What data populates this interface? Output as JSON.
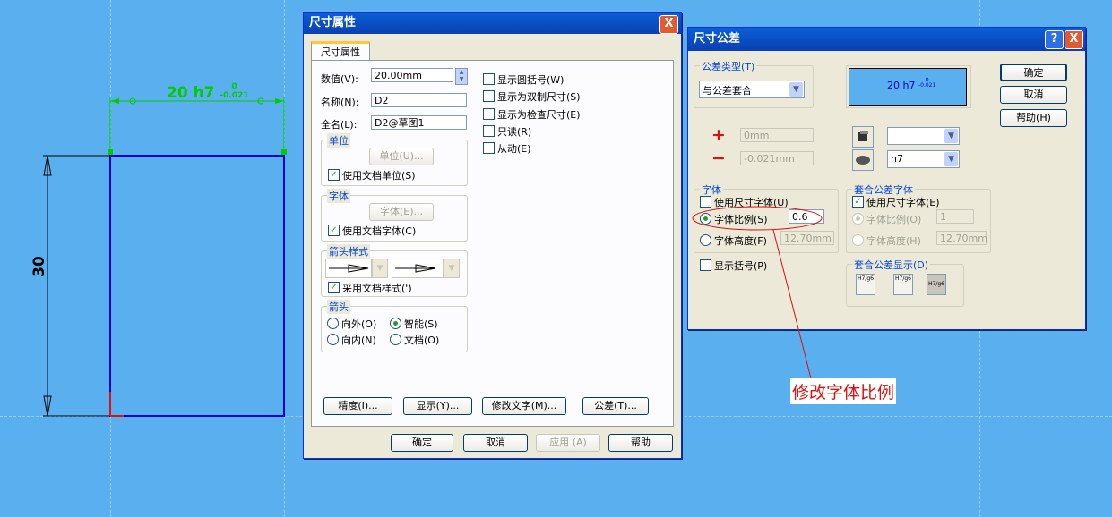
{
  "canvas": {
    "dim_h_text": "20 h7",
    "dim_h_upper": "0",
    "dim_h_lower": "-0.021",
    "dim_v_text": "30"
  },
  "dim_props": {
    "title": "尺寸属性",
    "close": "X",
    "tab": "尺寸属性",
    "value_label": "数值(V):",
    "value": "20.00mm",
    "name_label": "名称(N):",
    "name": "D2",
    "fullname_label": "全名(L):",
    "fullname": "D2@草图1",
    "checks": [
      "显示圆括号(W)",
      "显示为双制尺寸(S)",
      "显示为检查尺寸(E)",
      "只读(R)",
      "从动(E)"
    ],
    "unit_group": "单位",
    "unit_button": "单位(U)...",
    "unit_check": "使用文档单位(S)",
    "font_group": "字体",
    "font_button": "字体(E)...",
    "font_check": "使用文档字体(C)",
    "arrow_style_group": "箭头样式",
    "arrow_style_check": "采用文档样式(')",
    "arrow_group": "箭头",
    "radio_out": "向外(O)",
    "radio_smart": "智能(S)",
    "radio_in": "向内(N)",
    "radio_doc": "文档(O)",
    "precision_button": "精度(I)...",
    "display_button": "显示(Y)...",
    "modify_text_button": "修改文字(M)...",
    "tolerance_button": "公差(T)...",
    "ok": "确定",
    "cancel": "取消",
    "apply": "应用 (A)",
    "help": "帮助"
  },
  "tolerance": {
    "title": "尺寸公差",
    "help_icon": "?",
    "close": "X",
    "type_group": "公差类型(T)",
    "type_value": "与公差套合",
    "preview_main": "20 h7",
    "preview_upper": "0",
    "preview_lower": "-0.021",
    "ok": "确定",
    "cancel": "取消",
    "help": "帮助(H)",
    "plus": "+",
    "minus": "−",
    "plus_value": "0mm",
    "minus_value": "-0.021mm",
    "hole_select": "",
    "shaft_select": "h7",
    "font_group": "字体",
    "use_dim_font": "使用尺寸字体(U)",
    "font_ratio": "字体比例(S)",
    "font_ratio_value": "0.6",
    "font_height": "字体高度(F)",
    "font_height_value": "12.70mm",
    "fit_font_group": "套合公差字体",
    "fit_use_dim_font": "使用尺寸字体(E)",
    "fit_font_ratio": "字体比例(O)",
    "fit_font_ratio_value": "1",
    "fit_font_height": "字体高度(H)",
    "fit_font_height_value": "12.70mm",
    "show_brackets": "显示括号(P)",
    "fit_display_group": "套合公差显示(D)",
    "fit_display_options": [
      "H7/g6",
      "H7/g6",
      "H7/g6"
    ]
  },
  "annotation": "修改字体比例",
  "colors": {
    "dim_green": "#00cc00",
    "sketch_blue": "#0000dd",
    "annot_red": "#dd1111"
  }
}
